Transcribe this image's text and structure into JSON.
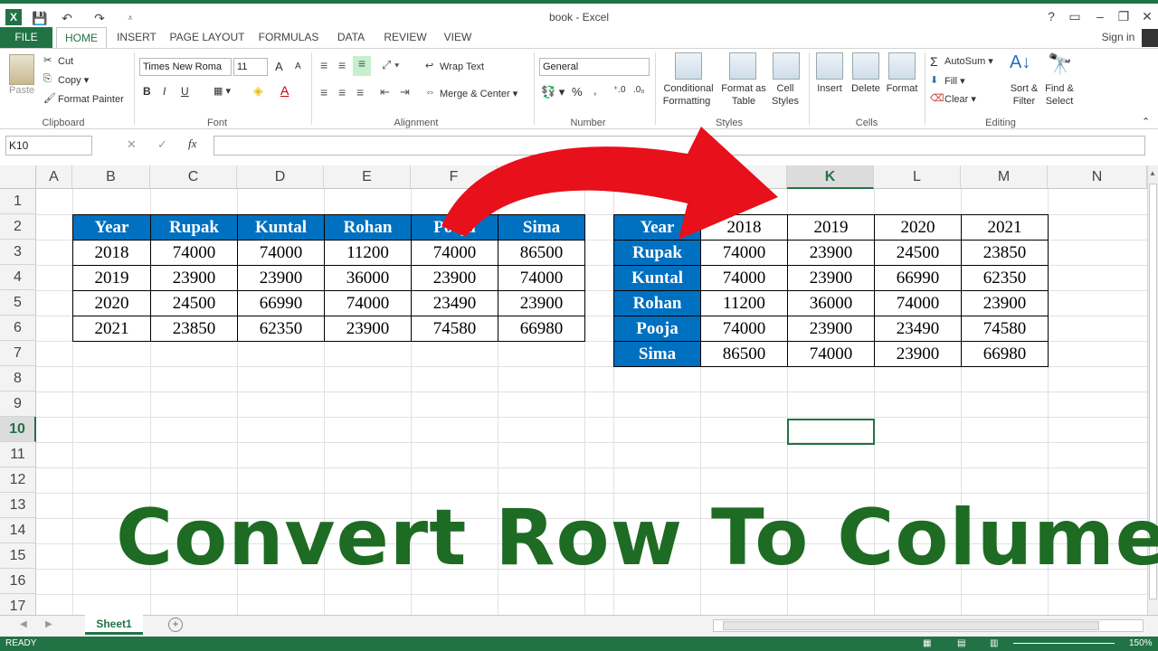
{
  "window": {
    "title": "book - Excel",
    "help": "?",
    "sign_in": "Sign in"
  },
  "tabs": [
    "FILE",
    "HOME",
    "INSERT",
    "PAGE LAYOUT",
    "FORMULAS",
    "DATA",
    "REVIEW",
    "VIEW"
  ],
  "ribbon": {
    "clipboard": {
      "paste": "Paste",
      "cut": "Cut",
      "copy": "Copy",
      "format_painter": "Format Painter",
      "group": "Clipboard"
    },
    "font": {
      "name": "Times New Roma",
      "size": "11",
      "bold": "B",
      "italic": "I",
      "underline": "U",
      "grow": "A",
      "shrink": "A",
      "color": "A",
      "group": "Font"
    },
    "alignment": {
      "wrap": "Wrap Text",
      "merge": "Merge & Center",
      "group": "Alignment"
    },
    "number": {
      "format": "General",
      "percent": "%",
      "comma": ",",
      "group": "Number"
    },
    "styles": {
      "conditional": "Conditional",
      "formatting": "Formatting",
      "format_as": "Format as",
      "table": "Table",
      "cell": "Cell",
      "cell_styles": "Styles",
      "group": "Styles"
    },
    "cells": {
      "insert": "Insert",
      "delete": "Delete",
      "format": "Format",
      "group": "Cells"
    },
    "editing": {
      "autosum": "AutoSum",
      "fill": "Fill",
      "clear": "Clear",
      "sort": "Sort &",
      "filter": "Filter",
      "find": "Find &",
      "select": "Select",
      "group": "Editing"
    }
  },
  "formula_bar": {
    "name_box": "K10",
    "fx": "fx",
    "x": "✕",
    "check": "✓",
    "value": ""
  },
  "columns": [
    "A",
    "B",
    "C",
    "D",
    "E",
    "F",
    "G",
    "H",
    "I",
    "J",
    "K",
    "L",
    "M",
    "N"
  ],
  "rows": [
    "1",
    "2",
    "3",
    "4",
    "5",
    "6",
    "7",
    "8",
    "9",
    "10",
    "11",
    "12",
    "13",
    "14",
    "15",
    "16",
    "17"
  ],
  "table1": {
    "header": [
      "Year",
      "Rupak",
      "Kuntal",
      "Rohan",
      "Pooja",
      "Sima"
    ],
    "rows": [
      [
        "2018",
        "74000",
        "74000",
        "11200",
        "74000",
        "86500"
      ],
      [
        "2019",
        "23900",
        "23900",
        "36000",
        "23900",
        "74000"
      ],
      [
        "2020",
        "24500",
        "66990",
        "74000",
        "23490",
        "23900"
      ],
      [
        "2021",
        "23850",
        "62350",
        "23900",
        "74580",
        "66980"
      ]
    ]
  },
  "table2": {
    "header": [
      "Year",
      "2018",
      "2019",
      "2020",
      "2021"
    ],
    "rows": [
      [
        "Rupak",
        "74000",
        "23900",
        "24500",
        "23850"
      ],
      [
        "Kuntal",
        "74000",
        "23900",
        "66990",
        "62350"
      ],
      [
        "Rohan",
        "11200",
        "36000",
        "74000",
        "23900"
      ],
      [
        "Pooja",
        "74000",
        "23900",
        "23490",
        "74580"
      ],
      [
        "Sima",
        "86500",
        "74000",
        "23900",
        "66980"
      ]
    ]
  },
  "sheet_tab": "Sheet1",
  "status": {
    "text": "READY",
    "zoom": "150%"
  },
  "headline": "Convert Row To Colume",
  "colors": {
    "excel_green": "#217346",
    "header_blue": "#0070c0",
    "headline_green": "#1e6b23",
    "arrow_red": "#e8101a"
  }
}
